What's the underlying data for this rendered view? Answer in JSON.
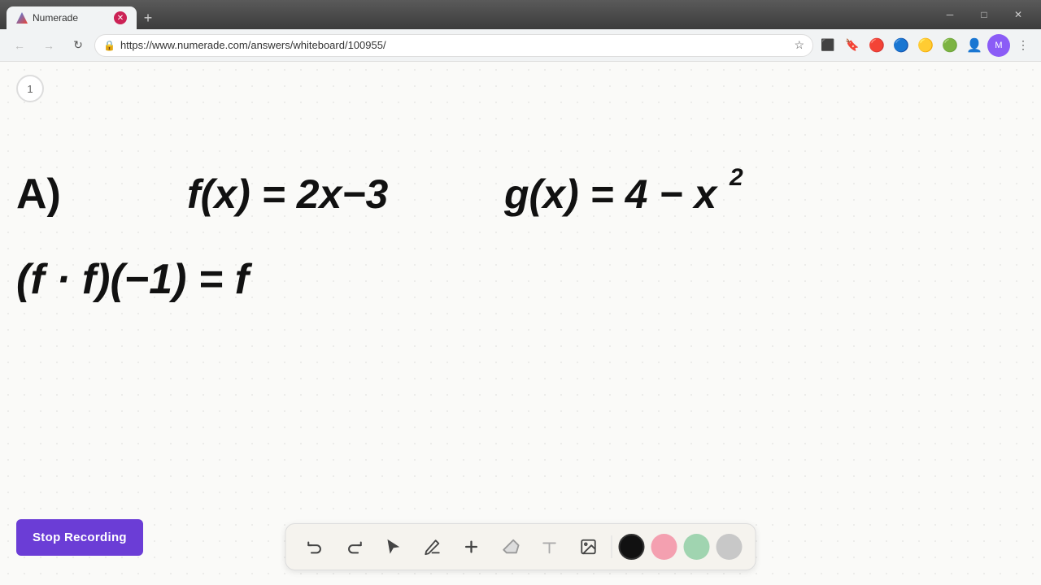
{
  "browser": {
    "tab_title": "Numerade",
    "url": "https://www.numerade.com/answers/whiteboard/100955/",
    "favicon_alt": "Numerade favicon"
  },
  "window_controls": {
    "minimize": "─",
    "maximize": "□",
    "close": "✕"
  },
  "toolbar": {
    "back": "←",
    "forward": "→",
    "reload": "↻"
  },
  "page_indicator": "1",
  "stop_recording_label": "Stop Recording",
  "bottom_toolbar": {
    "undo_label": "undo",
    "redo_label": "redo",
    "select_label": "select",
    "pen_label": "pen",
    "add_label": "add",
    "eraser_label": "eraser",
    "text_label": "text",
    "image_label": "image",
    "colors": [
      {
        "name": "black",
        "hex": "#111111"
      },
      {
        "name": "pink",
        "hex": "#f4a0b0"
      },
      {
        "name": "green",
        "hex": "#a0d4b0"
      },
      {
        "name": "gray",
        "hex": "#c8c8c8"
      }
    ]
  },
  "math_content": {
    "line1_left": "A)",
    "line1_f": "f(x) = 2x−3",
    "line1_g": "g(x) = 4 − x²",
    "line2": "(f · f)(−1) = f"
  }
}
